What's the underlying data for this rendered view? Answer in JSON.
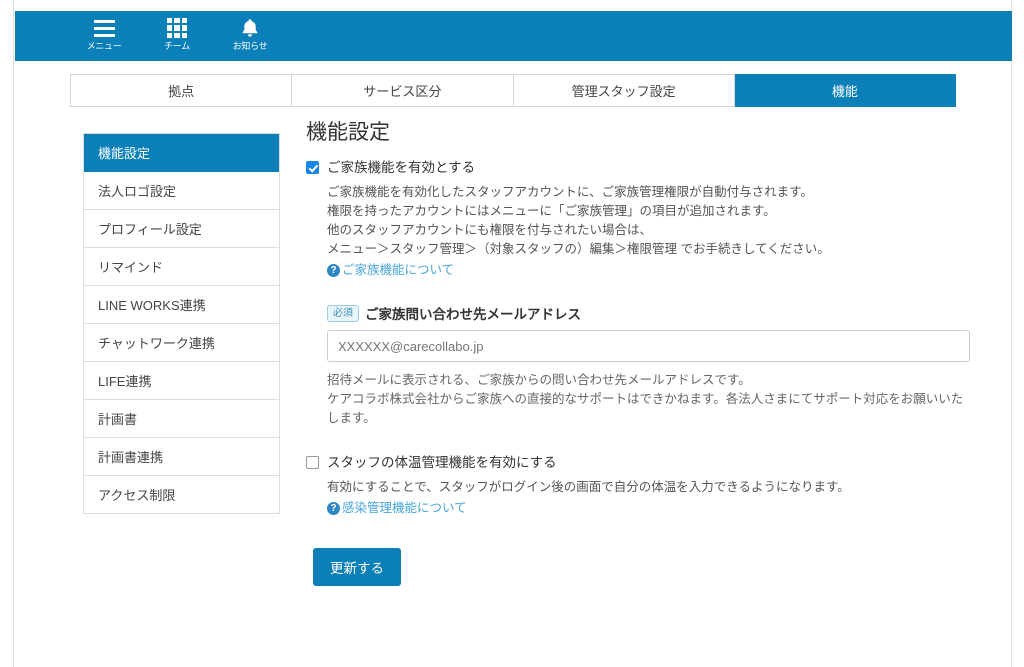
{
  "theme": {
    "primary": "#0b7fb8",
    "link": "#4aa6dd",
    "checkbox_checked": "#1a86e8",
    "badge_text": "#3b8fc4",
    "badge_bg": "#eaf5fb",
    "border": "#dddddd"
  },
  "header": {
    "items": [
      {
        "icon": "hamburger-menu-icon",
        "label": "メニュー"
      },
      {
        "icon": "grid-team-icon",
        "label": "チーム"
      },
      {
        "icon": "bell-notification-icon",
        "label": "お知らせ"
      }
    ]
  },
  "tabs": [
    {
      "label": "拠点",
      "active": false
    },
    {
      "label": "サービス区分",
      "active": false
    },
    {
      "label": "管理スタッフ設定",
      "active": false
    },
    {
      "label": "機能",
      "active": true
    }
  ],
  "sidebar": {
    "items": [
      {
        "label": "機能設定",
        "active": true
      },
      {
        "label": "法人ロゴ設定",
        "active": false
      },
      {
        "label": "プロフィール設定",
        "active": false
      },
      {
        "label": "リマインド",
        "active": false
      },
      {
        "label": "LINE WORKS連携",
        "active": false
      },
      {
        "label": "チャットワーク連携",
        "active": false
      },
      {
        "label": "LIFE連携",
        "active": false
      },
      {
        "label": "計画書",
        "active": false
      },
      {
        "label": "計画書連携",
        "active": false
      },
      {
        "label": "アクセス制限",
        "active": false
      }
    ]
  },
  "main": {
    "page_title": "機能設定",
    "family_feature": {
      "checkbox_label": "ご家族機能を有効とする",
      "checked": true,
      "description_lines": [
        "ご家族機能を有効化したスタッフアカウントに、ご家族管理権限が自動付与されます。",
        "権限を持ったアカウントにはメニューに「ご家族管理」の項目が追加されます。",
        "他のスタッフアカウントにも権限を付与されたい場合は、",
        "メニュー＞スタッフ管理＞（対象スタッフの）編集＞権限管理 でお手続きしてください。"
      ],
      "help_link": "ご家族機能について",
      "help_icon": "question-circle-icon"
    },
    "email_field": {
      "required_badge": "必須",
      "label": "ご家族問い合わせ先メールアドレス",
      "value": "XXXXXX@carecollabo.jp",
      "placeholder": "",
      "note_lines": [
        "招待メールに表示される、ご家族からの問い合わせ先メールアドレスです。",
        "ケアコラボ株式会社からご家族への直接的なサポートはできかねます。各法人さまにてサポート対応をお願いいたします。"
      ]
    },
    "temperature_feature": {
      "checkbox_label": "スタッフの体温管理機能を有効にする",
      "checked": false,
      "description_lines": [
        "有効にすることで、スタッフがログイン後の画面で自分の体温を入力できるようになります。"
      ],
      "help_link": "感染管理機能について",
      "help_icon": "question-circle-icon"
    },
    "submit_label": "更新する"
  }
}
